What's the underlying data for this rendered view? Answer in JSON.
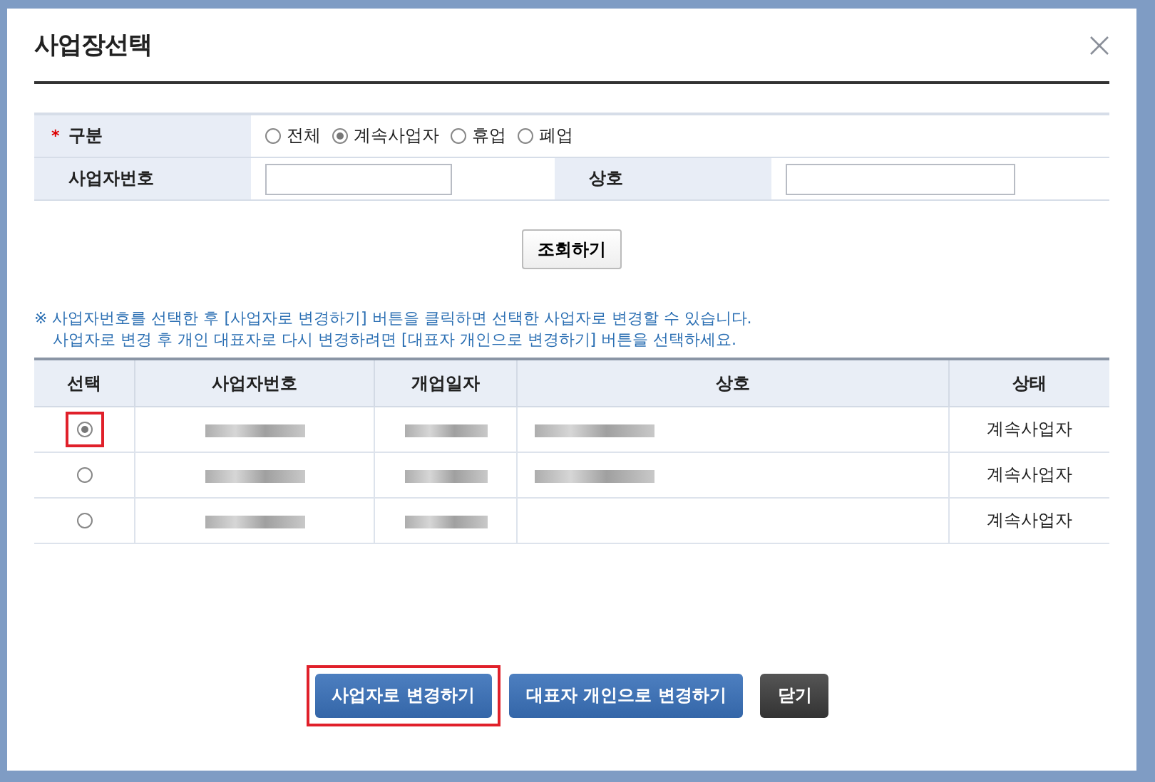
{
  "dialog": {
    "title": "사업장선택"
  },
  "filter": {
    "type_label": "구분",
    "required_mark": "*",
    "type_options": [
      {
        "label": "전체",
        "selected": false
      },
      {
        "label": "계속사업자",
        "selected": true
      },
      {
        "label": "휴업",
        "selected": false
      },
      {
        "label": "폐업",
        "selected": false
      }
    ],
    "business_number_label": "사업자번호",
    "business_name_label": "상호",
    "search_button": "조회하기"
  },
  "notice": [
    "※ 사업자번호를 선택한 후 [사업자로 변경하기] 버튼을 클릭하면 선택한 사업자로 변경할 수 있습니다.",
    "사업자로 변경 후 개인 대표자로 다시 변경하려면 [대표자 개인으로 변경하기] 버튼을 선택하세요."
  ],
  "table": {
    "columns": [
      "선택",
      "사업자번호",
      "개업일자",
      "상호",
      "상태"
    ],
    "rows": [
      {
        "selected": true,
        "highlighted": true,
        "business_number_redacted": true,
        "open_date_redacted": true,
        "name_redacted": true,
        "status": "계속사업자"
      },
      {
        "selected": false,
        "highlighted": false,
        "business_number_redacted": true,
        "open_date_redacted": true,
        "name_redacted": true,
        "status": "계속사업자"
      },
      {
        "selected": false,
        "highlighted": false,
        "business_number_redacted": true,
        "open_date_redacted": true,
        "name_redacted": false,
        "status": "계속사업자"
      }
    ]
  },
  "buttons": [
    {
      "label": "사업자로 변경하기",
      "kind": "primary",
      "highlighted": true
    },
    {
      "label": "대표자 개인으로 변경하기",
      "kind": "primary",
      "highlighted": false
    },
    {
      "label": "닫기",
      "kind": "dark",
      "highlighted": false
    }
  ]
}
